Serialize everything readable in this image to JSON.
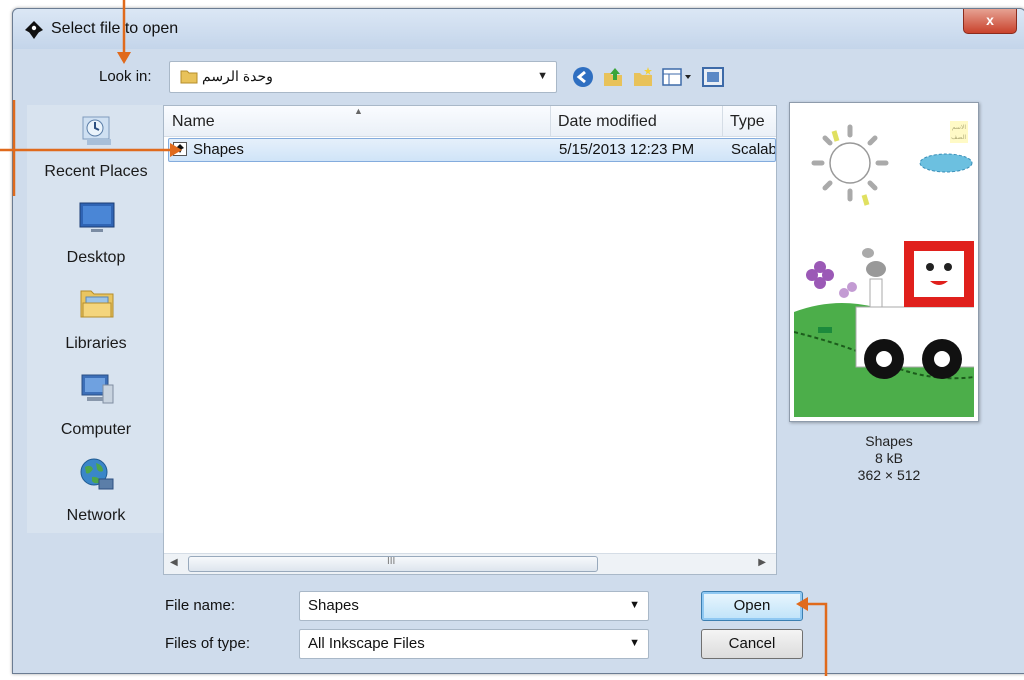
{
  "window": {
    "title": "Select file to open",
    "close_label": "x"
  },
  "lookin": {
    "label": "Look in:",
    "value": "وحدة الرسم",
    "dropdown_icon": "chevron-down"
  },
  "toolbar": {
    "buttons": [
      "back-icon",
      "up-folder-icon",
      "new-folder-icon",
      "view-menu-icon",
      "preview-toggle-icon"
    ]
  },
  "places": [
    {
      "label": "Recent Places",
      "icon": "recent-places-icon"
    },
    {
      "label": "Desktop",
      "icon": "desktop-icon"
    },
    {
      "label": "Libraries",
      "icon": "libraries-icon"
    },
    {
      "label": "Computer",
      "icon": "computer-icon"
    },
    {
      "label": "Network",
      "icon": "network-icon"
    }
  ],
  "filelist": {
    "columns": {
      "name": "Name",
      "date": "Date modified",
      "type": "Type"
    },
    "rows": [
      {
        "name": "Shapes",
        "date": "5/15/2013 12:23 PM",
        "type": "Scalab"
      }
    ],
    "scroll_grip": "III"
  },
  "preview": {
    "name": "Shapes",
    "size": "8 kB",
    "dimensions": "362 × 512"
  },
  "form": {
    "filename_label": "File name:",
    "filename_value": "Shapes",
    "filetype_label": "Files of type:",
    "filetype_value": "All Inkscape Files"
  },
  "buttons": {
    "open": "Open",
    "cancel": "Cancel"
  },
  "colors": {
    "annotation_arrow": "#e06a1c",
    "selection": "#d0e4f8"
  }
}
